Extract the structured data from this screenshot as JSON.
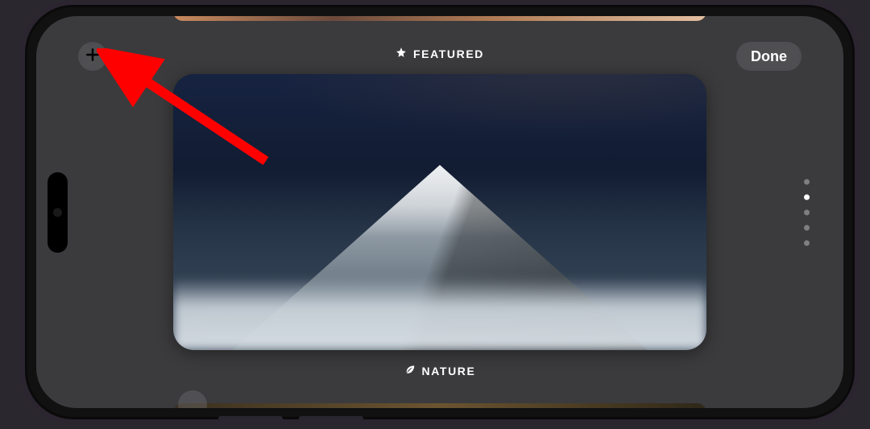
{
  "header": {
    "add_icon": "plus-icon",
    "done_label": "Done",
    "featured_label": "FEATURED",
    "featured_icon": "star-icon"
  },
  "card": {
    "category_label": "NATURE",
    "category_icon": "leaf-icon"
  },
  "pager": {
    "count": 5,
    "active_index": 1
  },
  "annotation": {
    "target": "add-button",
    "color": "#ff0000"
  }
}
